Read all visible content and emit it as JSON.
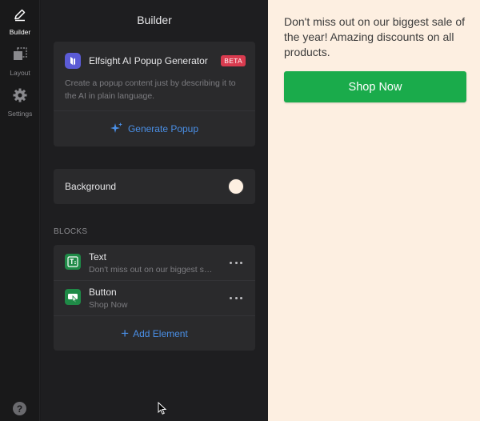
{
  "rail": {
    "items": [
      {
        "label": "Builder",
        "icon": "pencil-icon",
        "active": true
      },
      {
        "label": "Layout",
        "icon": "layout-icon",
        "active": false
      },
      {
        "label": "Settings",
        "icon": "gear-icon",
        "active": false
      }
    ],
    "help_glyph": "?"
  },
  "panel": {
    "title": "Builder",
    "ai_card": {
      "title": "Elfsight AI Popup Generator",
      "badge": "BETA",
      "description": "Create a popup content just by describing it to the AI in plain language.",
      "button_label": "Generate Popup"
    },
    "background": {
      "label": "Background",
      "color": "#fdefe1"
    },
    "blocks_heading": "BLOCKS",
    "blocks": [
      {
        "name": "Text",
        "preview": "Don't miss out on our biggest sale of the year! Amazing discounts on all products.",
        "icon": "text-block-icon"
      },
      {
        "name": "Button",
        "preview": "Shop Now",
        "icon": "button-block-icon"
      }
    ],
    "add_element_label": "Add Element"
  },
  "preview": {
    "text": "Don't miss out on our biggest sale of the year! Amazing discounts on all products.",
    "button_label": "Shop Now",
    "button_color": "#1aab4b",
    "background_color": "#fdefe1"
  },
  "colors": {
    "accent": "#4a8fe6",
    "badge": "#d93b4f",
    "block_icon": "#1f8a47"
  }
}
